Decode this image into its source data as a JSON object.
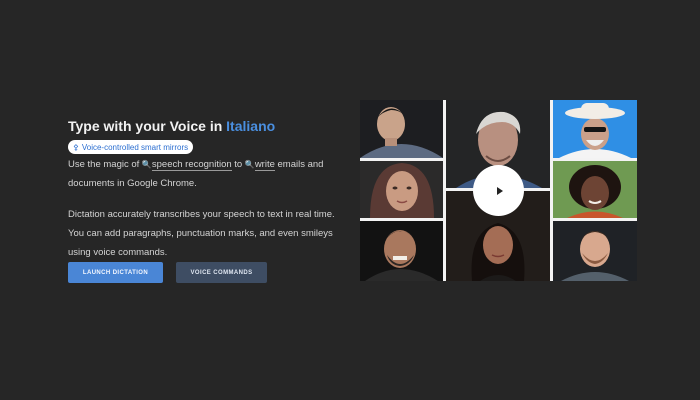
{
  "hero": {
    "title_prefix": "Type with your Voice in ",
    "title_language": "Italiano",
    "chip": {
      "icon": "tag-icon",
      "label": "Voice-controlled smart mirrors"
    },
    "para1": {
      "text_a": "Use the magic of ",
      "keyword1": "speech recognition",
      "text_b": " to ",
      "keyword2": "write",
      "text_c": " emails and documents in Google Chrome."
    },
    "para2": "Dictation accurately transcribes your speech to text in real time. You can add paragraphs, punctuation marks, and even smileys using voice commands.",
    "buttons": {
      "primary": "LAUNCH DICTATION",
      "secondary": "VOICE COMMANDS"
    }
  },
  "video": {
    "tiles": [
      "portrait-young-man-dark-hair",
      "portrait-elderly-man",
      "portrait-man-white-hat-sunglasses",
      "portrait-woman-headscarf",
      "portrait-woman-curly-hair",
      "portrait-smiling-man-beard",
      "portrait-woman-long-dark-hair",
      "portrait-young-man-beard"
    ],
    "play_icon": "play-icon"
  },
  "colors": {
    "background": "#262626",
    "accent": "#4a8fe0",
    "primary_button": "#4a86d6",
    "secondary_button": "#3e4d63"
  }
}
